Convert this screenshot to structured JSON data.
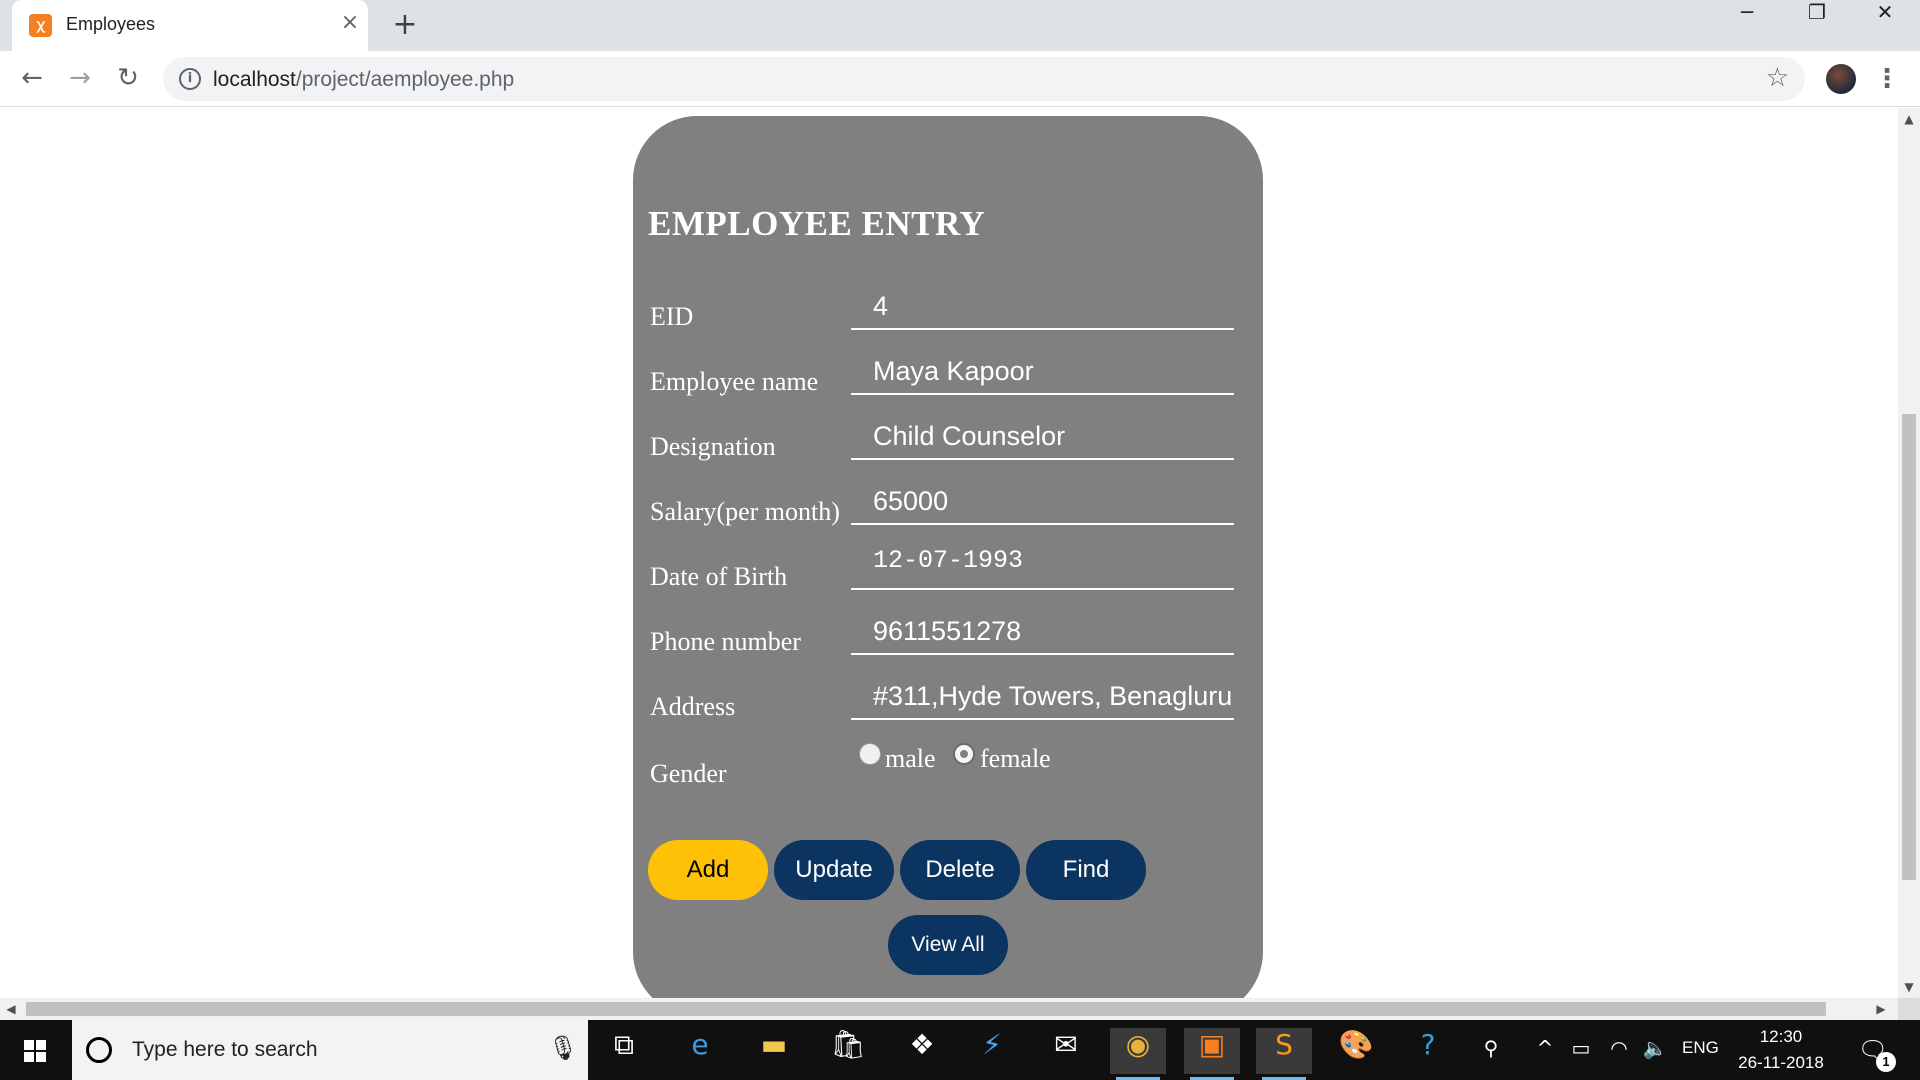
{
  "browser": {
    "tab_title": "Employees",
    "tab_close": "×",
    "new_tab": "+",
    "window_minimize": "─",
    "window_restore": "❐",
    "window_close": "✕",
    "url_host": "localhost",
    "url_path": "/project/aemployee.php",
    "info_glyph": "i"
  },
  "form": {
    "title": "EMPLOYEE ENTRY",
    "fields": [
      {
        "label": "EID",
        "value": "4"
      },
      {
        "label": "Employee name",
        "value": "Maya Kapoor"
      },
      {
        "label": "Designation",
        "value": "Child Counselor"
      },
      {
        "label": "Salary(per month)",
        "value": "65000"
      },
      {
        "label": "Date of Birth",
        "value": "12-07-1993"
      },
      {
        "label": "Phone number",
        "value": "9611551278"
      },
      {
        "label": "Address",
        "value": "#311,Hyde Towers, Benagluru"
      }
    ],
    "gender": {
      "label": "Gender",
      "options": [
        "male",
        "female"
      ],
      "selected": "female"
    },
    "buttons": {
      "add": "Add",
      "update": "Update",
      "delete": "Delete",
      "find": "Find",
      "view_all": "View All"
    },
    "colors": {
      "card": "#808080",
      "primary_button": "#ffc107",
      "secondary_button": "#0b3461"
    }
  },
  "taskbar": {
    "search_placeholder": "Type here to search",
    "language": "ENG",
    "time": "12:30",
    "date": "26-11-2018",
    "notification_count": "1",
    "pinned_icons": [
      "task-view-icon",
      "edge-icon",
      "file-explorer-icon",
      "store-icon",
      "dropbox-icon",
      "visual-studio-icon",
      "mail-icon",
      "chrome-icon",
      "xampp-icon",
      "sublime-text-icon",
      "paint-icon",
      "help-icon"
    ]
  }
}
